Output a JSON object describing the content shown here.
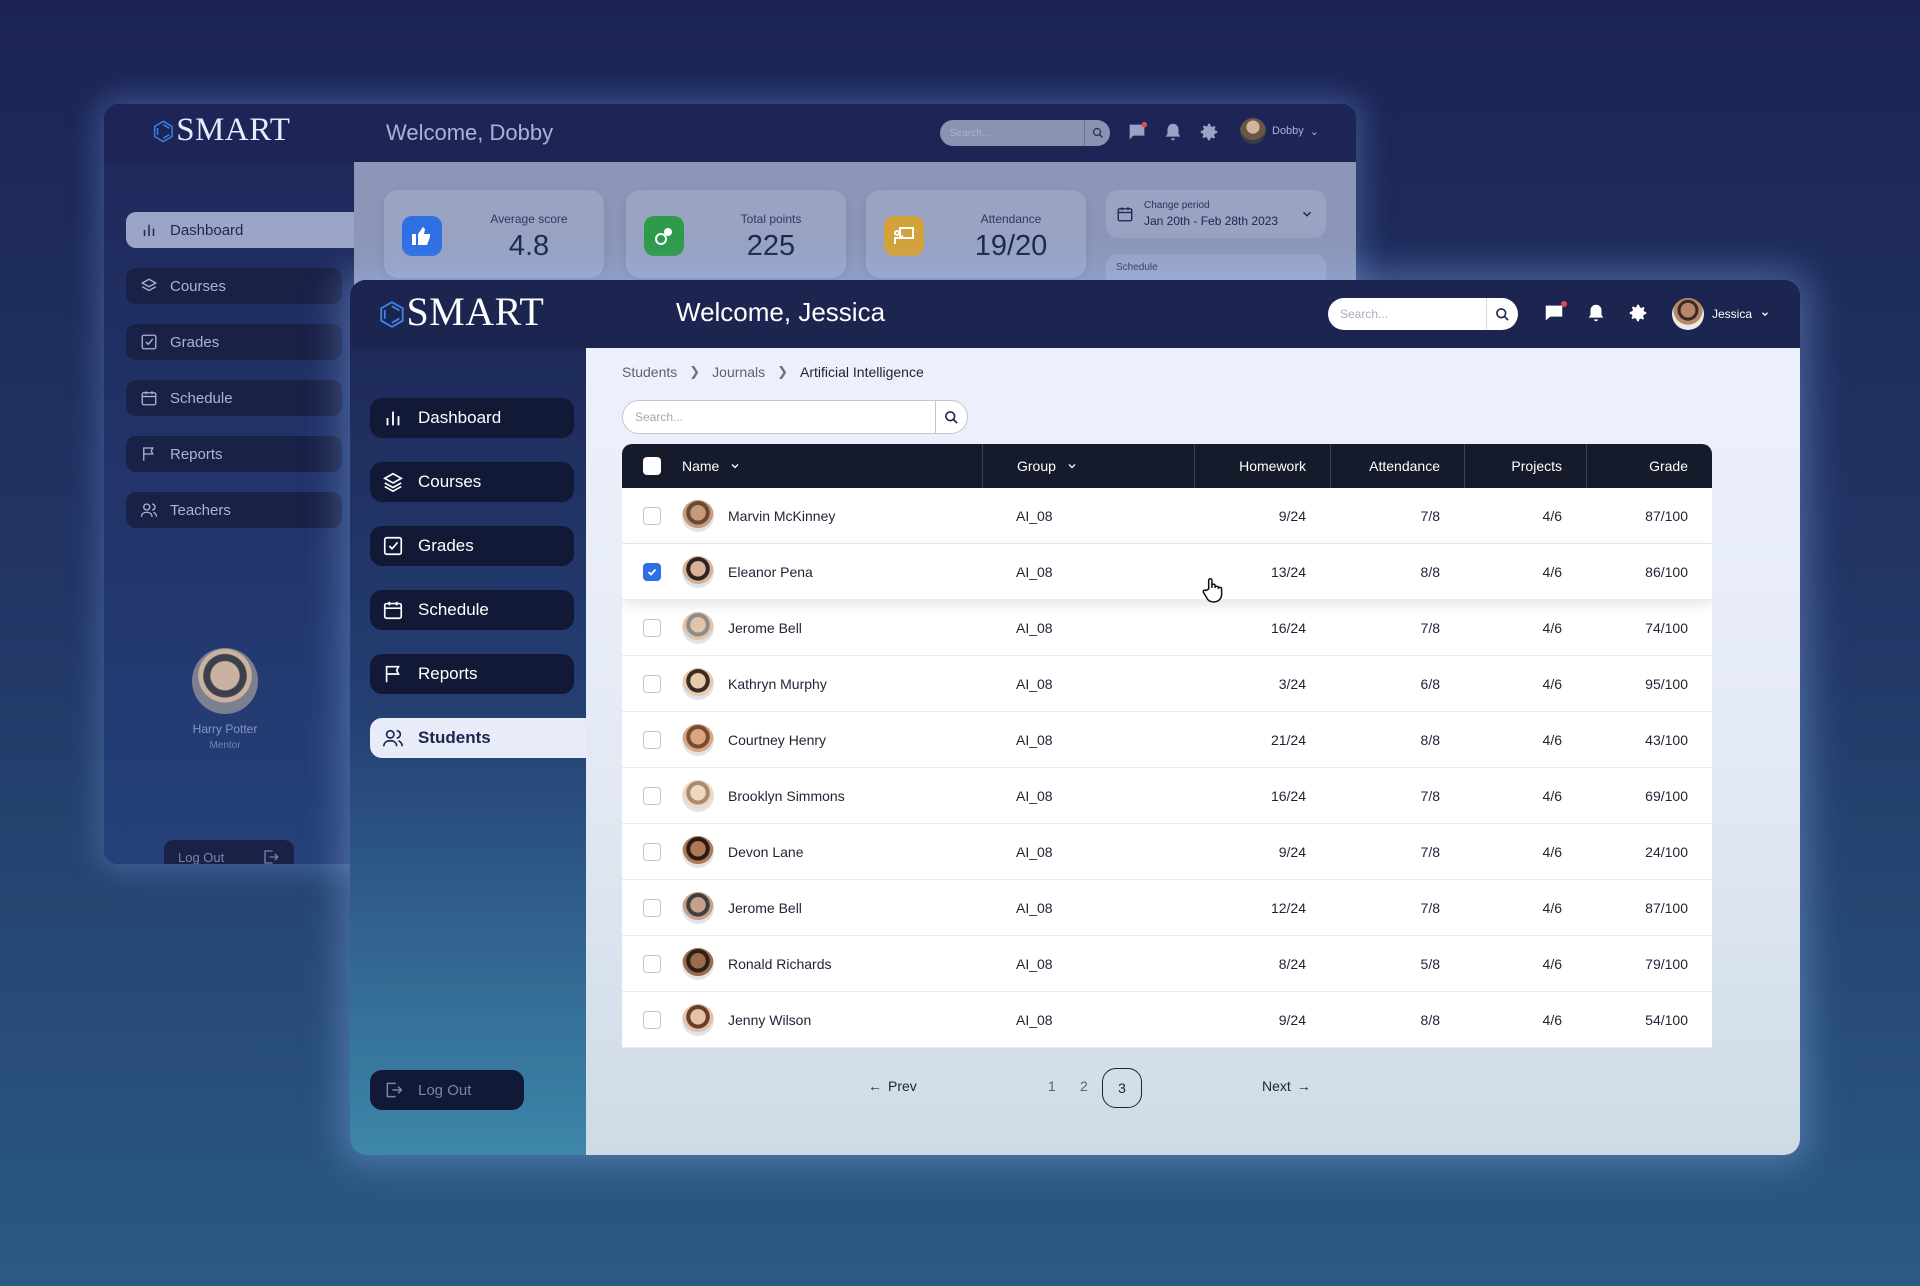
{
  "back_window": {
    "logo": "SMART",
    "welcome": "Welcome, Dobby",
    "search_placeholder": "Search...",
    "user_name": "Dobby",
    "nav": [
      {
        "label": "Dashboard",
        "icon": "bar-chart-icon"
      },
      {
        "label": "Courses",
        "icon": "layers-icon"
      },
      {
        "label": "Grades",
        "icon": "check-square-icon"
      },
      {
        "label": "Schedule",
        "icon": "calendar-icon"
      },
      {
        "label": "Reports",
        "icon": "flag-icon"
      },
      {
        "label": "Teachers",
        "icon": "users-icon"
      }
    ],
    "profile": {
      "name": "Harry Potter",
      "role": "Mentor"
    },
    "logout": "Log Out",
    "stats": [
      {
        "label": "Average score",
        "value": "4.8",
        "color": "#2f6fe4"
      },
      {
        "label": "Total points",
        "value": "225",
        "color": "#2e9a4a"
      },
      {
        "label": "Attendance",
        "value": "19/20",
        "color": "#d4a23a"
      }
    ],
    "period": {
      "label": "Change period",
      "value": "Jan 20th - Feb 28th 2023"
    },
    "schedule_label": "Schedule"
  },
  "front_window": {
    "logo": "SMART",
    "welcome": "Welcome, Jessica",
    "search_placeholder": "Search...",
    "user_name": "Jessica",
    "nav": [
      {
        "label": "Dashboard",
        "icon": "bar-chart-icon"
      },
      {
        "label": "Courses",
        "icon": "layers-icon"
      },
      {
        "label": "Grades",
        "icon": "check-square-icon"
      },
      {
        "label": "Schedule",
        "icon": "calendar-icon"
      },
      {
        "label": "Reports",
        "icon": "flag-icon"
      },
      {
        "label": "Students",
        "icon": "users-icon"
      }
    ],
    "logout": "Log Out",
    "breadcrumb": [
      "Students",
      "Journals",
      "Artificial Intelligence"
    ],
    "table_search_placeholder": "Search...",
    "table": {
      "columns": [
        "Name",
        "Group",
        "Homework",
        "Attendance",
        "Projects",
        "Grade"
      ],
      "rows": [
        {
          "name": "Marvin McKinney",
          "group": "AI_08",
          "homework": "9/24",
          "attendance": "7/8",
          "projects": "4/6",
          "grade": "87/100",
          "checked": false
        },
        {
          "name": "Eleanor Pena",
          "group": "AI_08",
          "homework": "13/24",
          "attendance": "8/8",
          "projects": "4/6",
          "grade": "86/100",
          "checked": true
        },
        {
          "name": "Jerome Bell",
          "group": "AI_08",
          "homework": "16/24",
          "attendance": "7/8",
          "projects": "4/6",
          "grade": "74/100",
          "checked": false
        },
        {
          "name": "Kathryn Murphy",
          "group": "AI_08",
          "homework": "3/24",
          "attendance": "6/8",
          "projects": "4/6",
          "grade": "95/100",
          "checked": false
        },
        {
          "name": "Courtney Henry",
          "group": "AI_08",
          "homework": "21/24",
          "attendance": "8/8",
          "projects": "4/6",
          "grade": "43/100",
          "checked": false
        },
        {
          "name": "Brooklyn Simmons",
          "group": "AI_08",
          "homework": "16/24",
          "attendance": "7/8",
          "projects": "4/6",
          "grade": "69/100",
          "checked": false
        },
        {
          "name": "Devon Lane",
          "group": "AI_08",
          "homework": "9/24",
          "attendance": "7/8",
          "projects": "4/6",
          "grade": "24/100",
          "checked": false
        },
        {
          "name": "Jerome Bell",
          "group": "AI_08",
          "homework": "12/24",
          "attendance": "7/8",
          "projects": "4/6",
          "grade": "87/100",
          "checked": false
        },
        {
          "name": "Ronald Richards",
          "group": "AI_08",
          "homework": "8/24",
          "attendance": "5/8",
          "projects": "4/6",
          "grade": "79/100",
          "checked": false
        },
        {
          "name": "Jenny Wilson",
          "group": "AI_08",
          "homework": "9/24",
          "attendance": "8/8",
          "projects": "4/6",
          "grade": "54/100",
          "checked": false
        }
      ]
    },
    "pagination": {
      "prev": "Prev",
      "next": "Next",
      "pages": [
        "1",
        "2",
        "3"
      ],
      "current": "3"
    }
  },
  "colors": {
    "accent": "#2f6fe4",
    "nav_dark": "#121936",
    "header_dark": "#161b2c",
    "notification": "#e74a4a"
  }
}
